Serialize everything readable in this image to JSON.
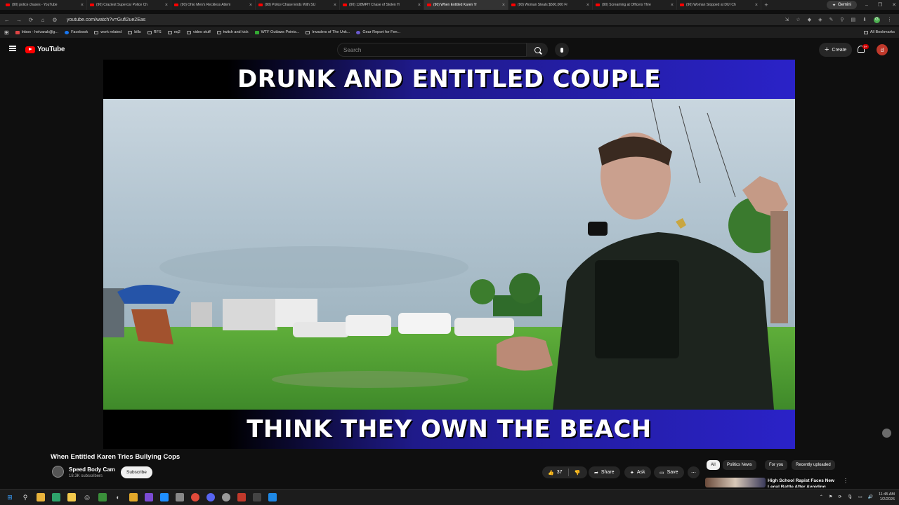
{
  "browser": {
    "tabs": [
      {
        "label": "(90) police chases - YouTube",
        "active": false
      },
      {
        "label": "(90) Craziest Supercar Police Ch",
        "active": false
      },
      {
        "label": "(90) Ohio Men's Reckless Attem",
        "active": false
      },
      {
        "label": "(90) Police Chase Ends With SU",
        "active": false
      },
      {
        "label": "(90) 128MPH Chase of Stolen H",
        "active": false
      },
      {
        "label": "(90) When Entitled Karen Tr",
        "active": true
      },
      {
        "label": "(90) Woman Steals $500,000 Fr",
        "active": false
      },
      {
        "label": "(90) Screaming at Officers Thre",
        "active": false
      },
      {
        "label": "(90) Woman Stopped at DUI Ch",
        "active": false
      }
    ],
    "gemini_label": "Gemini",
    "url": "youtube.com/watch?v=Gufi2ue2Eas",
    "profile_initial": "G",
    "bookmarks": [
      {
        "label": "Inbox - helvarak@g...",
        "icon": "gmail"
      },
      {
        "label": "Facebook",
        "icon": "facebook"
      },
      {
        "label": "work related",
        "icon": "folder"
      },
      {
        "label": "bills",
        "icon": "folder"
      },
      {
        "label": "RFS",
        "icon": "folder"
      },
      {
        "label": "eq2",
        "icon": "folder"
      },
      {
        "label": "video stuff",
        "icon": "folder"
      },
      {
        "label": "twitch and kick",
        "icon": "folder"
      },
      {
        "label": "WTF Outlaws Points...",
        "icon": "wtf"
      },
      {
        "label": "Invaders of The Unk...",
        "icon": "page"
      },
      {
        "label": "Gear Report for Fen...",
        "icon": "gear"
      }
    ],
    "all_bookmarks_label": "All Bookmarks"
  },
  "youtube": {
    "logo_text": "YouTube",
    "search_placeholder": "Search",
    "create_label": "Create",
    "notif_badge": "9+",
    "avatar_initial": "d"
  },
  "video": {
    "caption_top": "DRUNK AND ENTITLED COUPLE",
    "caption_bottom": "THINK THEY OWN THE BEACH",
    "title": "When Entitled Karen Tries Bullying Cops",
    "channel": "Speed Body Cam",
    "subscribers": "18.3K subscribers",
    "subscribe_label": "Subscribe",
    "likes": "37",
    "share_label": "Share",
    "ask_label": "Ask",
    "save_label": "Save"
  },
  "chips": [
    "All",
    "Politics News",
    "For you",
    "Recently uploaded"
  ],
  "recommendation": {
    "title": "High School Rapist Faces New Legal Battle After Avoiding"
  },
  "taskbar": {
    "time": "11:45 AM",
    "date": "1/2/2026"
  },
  "colors": {
    "yt_red": "#ff0000",
    "banner_blue": "#2a22c8",
    "background": "#0f0f0f"
  }
}
